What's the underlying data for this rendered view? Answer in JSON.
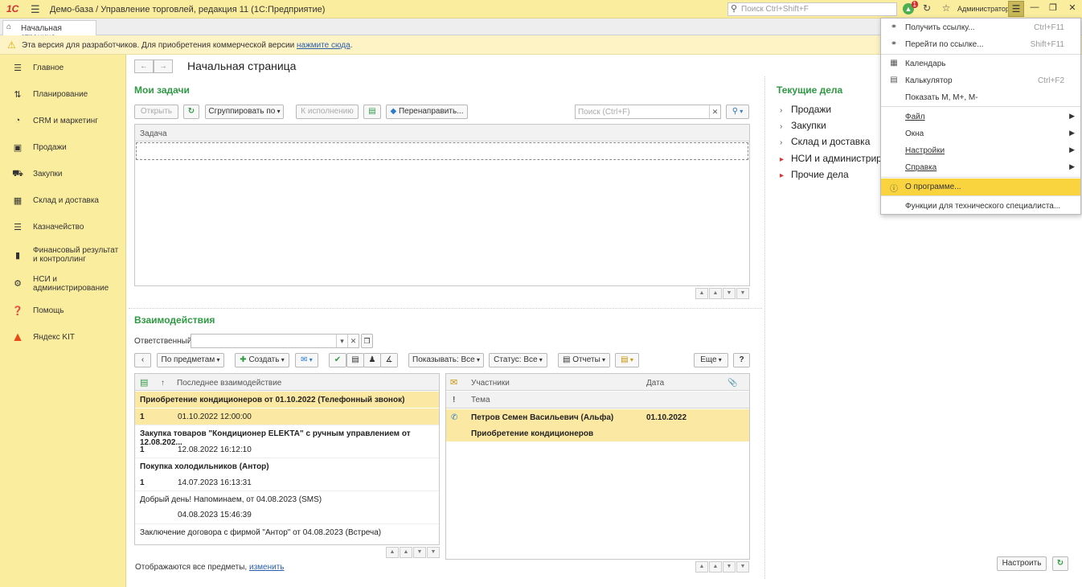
{
  "titlebar": {
    "logo": "1С",
    "title": "Демо-база / Управление торговлей, редакция 11  (1С:Предприятие)",
    "search_placeholder": "Поиск Ctrl+Shift+F",
    "notifications_count": "1",
    "user": "Администратор"
  },
  "tabs": [
    {
      "label": "Начальная страница"
    }
  ],
  "warning": {
    "text": "Эта версия для разработчиков. Для приобретения коммерческой версии",
    "link": "нажмите сюда",
    "suffix": "."
  },
  "sidebar": {
    "items": [
      {
        "label": "Главное",
        "icon": "list-icon"
      },
      {
        "label": "Планирование",
        "icon": "planning-icon"
      },
      {
        "label": "CRM и маркетинг",
        "icon": "pie-icon"
      },
      {
        "label": "Продажи",
        "icon": "bag-icon"
      },
      {
        "label": "Закупки",
        "icon": "cart-icon"
      },
      {
        "label": "Склад и доставка",
        "icon": "warehouse-icon"
      },
      {
        "label": "Казначейство",
        "icon": "coins-icon"
      },
      {
        "label": "Финансовый результат и контроллинг",
        "icon": "bars-icon"
      },
      {
        "label": "НСИ и администрирование",
        "icon": "gear-icon"
      },
      {
        "label": "Помощь",
        "icon": "help-icon"
      },
      {
        "label": "Яндекс KIT",
        "icon": "yandex-kit-icon"
      }
    ]
  },
  "page": {
    "title": "Начальная страница"
  },
  "tasks": {
    "title": "Мои задачи",
    "open": "Открыть",
    "group_by": "Сгруппировать по",
    "to_execution": "К исполнению",
    "redirect": "Перенаправить...",
    "search_placeholder": "Поиск (Ctrl+F)",
    "col_task": "Задача"
  },
  "interactions": {
    "title": "Взаимодействия",
    "responsible_label": "Ответственный:",
    "by_subject": "По предметам",
    "create": "Создать",
    "show": "Показывать: Все",
    "status": "Статус: Все",
    "reports": "Отчеты",
    "more": "Еще",
    "help": "?",
    "col_last": "Последнее взаимодействие",
    "sort_arrow": "↑",
    "rows": [
      {
        "title": "Приобретение кондиционеров от 01.10.2022 (Телефонный звонок)",
        "count": "1",
        "date": "01.10.2022 12:00:00",
        "bold": true,
        "selected": true
      },
      {
        "title": "Закупка товаров \"Кондиционер ELEKTA\" с ручным управлением от 12.08.202...",
        "count": "1",
        "date": "12.08.2022 16:12:10",
        "bold": true,
        "selected": false
      },
      {
        "title": "Покупка холодильников (Антор)",
        "count": "1",
        "date": "14.07.2023 16:13:31",
        "bold": true,
        "selected": false
      },
      {
        "title": "Добрый день! Напоминаем, от 04.08.2023 (SMS)",
        "count": "",
        "date": "04.08.2023 15:46:39",
        "bold": false,
        "selected": false
      },
      {
        "title": "Заключение договора с фирмой \"Антор\" от 04.08.2023 (Встреча)",
        "count": "",
        "date": "",
        "bold": false,
        "selected": false
      }
    ],
    "footer_text": "Отображаются все предметы,",
    "footer_link": "изменить",
    "detail": {
      "col_participants": "Участники",
      "col_date": "Дата",
      "col_topic": "Тема",
      "participant": "Петров Семен Васильевич (Альфа)",
      "date": "01.10.2022",
      "topic": "Приобретение кондиционеров"
    }
  },
  "current": {
    "title": "Текущие дела",
    "items": [
      {
        "label": "Продажи",
        "red": false
      },
      {
        "label": "Закупки",
        "red": false
      },
      {
        "label": "Склад и доставка",
        "red": false
      },
      {
        "label": "НСИ и администрир",
        "red": true
      },
      {
        "label": "Прочие дела",
        "red": true
      }
    ],
    "configure": "Настроить"
  },
  "menu": {
    "items": [
      {
        "label": "Получить ссылку...",
        "shortcut": "Ctrl+F11",
        "icon": "link-icon"
      },
      {
        "label": "Перейти по ссылке...",
        "shortcut": "Shift+F11",
        "icon": "goto-link-icon"
      },
      {
        "label": "Календарь",
        "shortcut": "",
        "icon": "calendar-icon"
      },
      {
        "label": "Калькулятор",
        "shortcut": "Ctrl+F2",
        "icon": "calculator-icon"
      },
      {
        "label": "Показать М, М+, М-",
        "shortcut": "",
        "icon": ""
      },
      {
        "label": "Файл",
        "shortcut": "",
        "icon": ""
      },
      {
        "label": "Окна",
        "shortcut": "",
        "icon": ""
      },
      {
        "label": "Настройки",
        "shortcut": "",
        "icon": ""
      },
      {
        "label": "Справка",
        "shortcut": "",
        "icon": ""
      },
      {
        "label": "О программе...",
        "shortcut": "",
        "icon": "info-icon"
      },
      {
        "label": "Функции для технического специалиста...",
        "shortcut": "",
        "icon": ""
      }
    ]
  }
}
